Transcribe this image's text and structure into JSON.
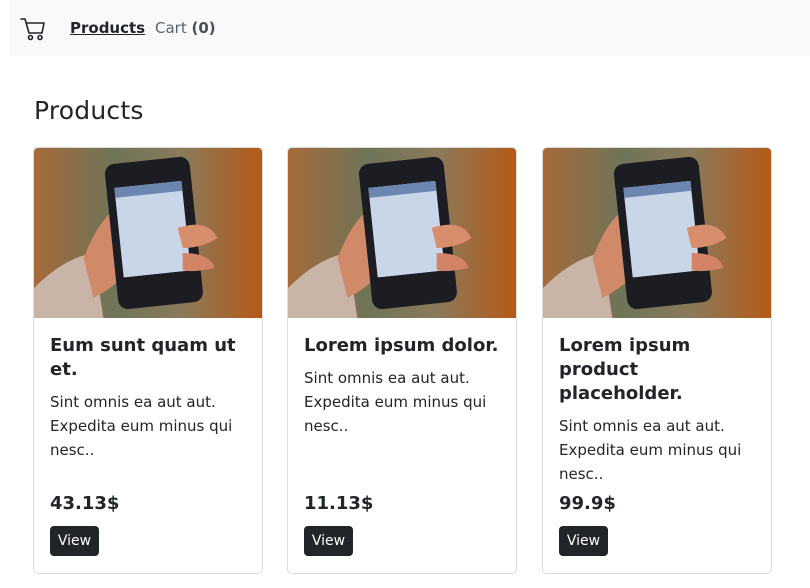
{
  "nav": {
    "cart_icon": "shopping-cart-icon",
    "products_label": "Products",
    "cart_label": "Cart",
    "cart_count": "(0)"
  },
  "page": {
    "title": "Products"
  },
  "products": [
    {
      "title": "Eum sunt quam ut et.",
      "description": "Sint omnis ea aut aut. Expedita eum minus qui nesc..",
      "price": "43.13$",
      "button_label": "View",
      "image": "smartphone-in-hand-photo"
    },
    {
      "title": "Lorem ipsum dolor.",
      "description": "Sint omnis ea aut aut. Expedita eum minus qui nesc..",
      "price": "11.13$",
      "button_label": "View",
      "image": "smartphone-in-hand-photo"
    },
    {
      "title": "Lorem ipsum product placeholder.",
      "description": "Sint omnis ea aut aut. Expedita eum minus qui nesc..",
      "price": "99.9$",
      "button_label": "View",
      "image": "smartphone-in-hand-photo"
    }
  ],
  "colors": {
    "navbar_bg": "#f8f9fa",
    "button_bg": "#212529",
    "card_border": "#dcdcdc"
  }
}
